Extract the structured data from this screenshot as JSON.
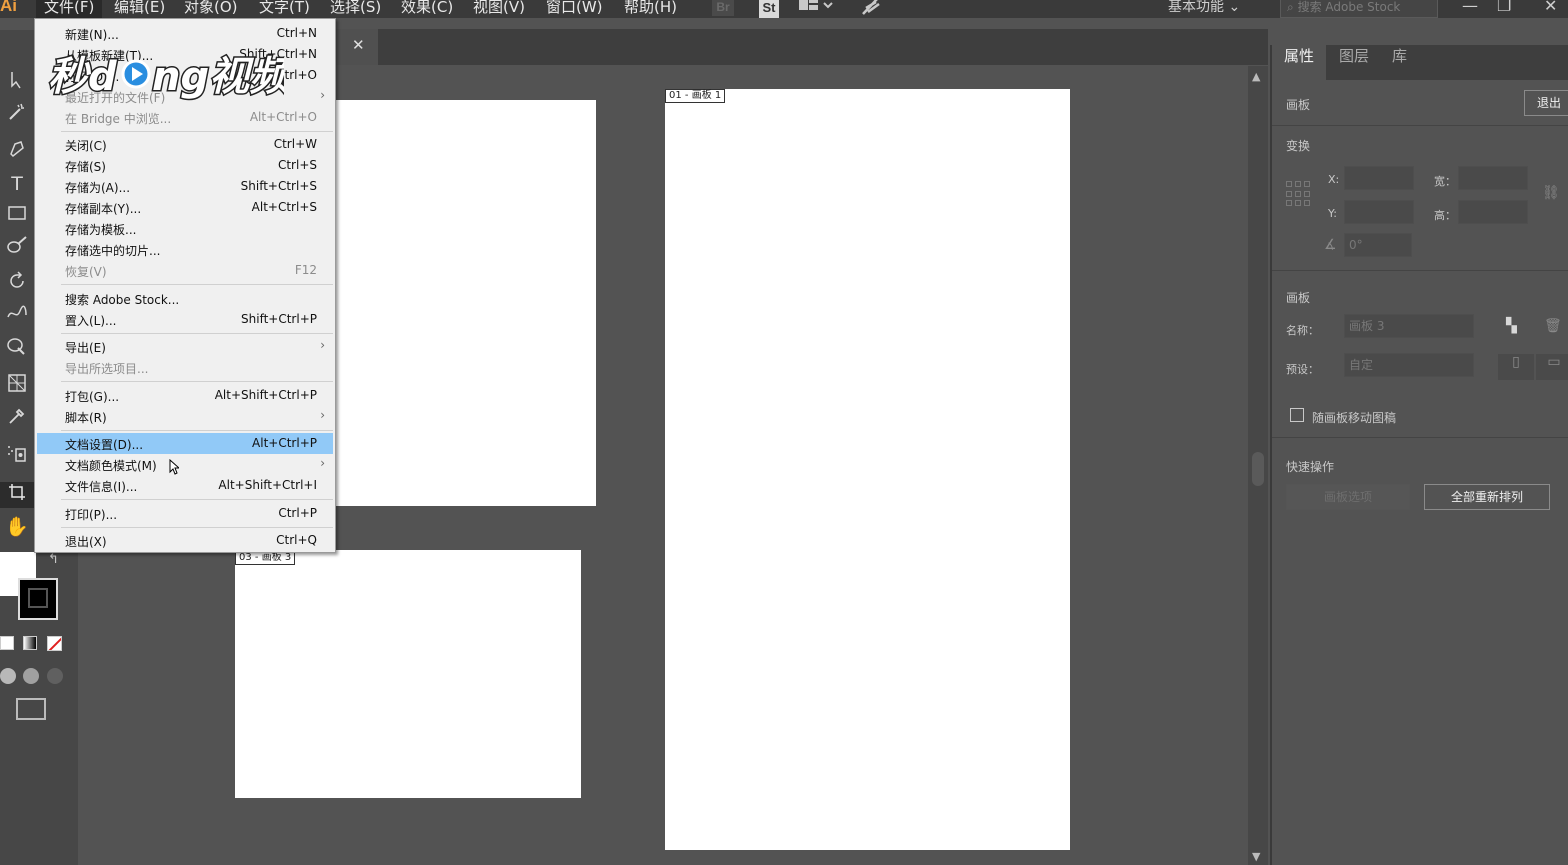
{
  "menubar": {
    "app_logo": "Ai",
    "menus": [
      {
        "label": "文件(F)"
      },
      {
        "label": "编辑(E)"
      },
      {
        "label": "对象(O)"
      },
      {
        "label": "文字(T)"
      },
      {
        "label": "选择(S)"
      },
      {
        "label": "效果(C)"
      },
      {
        "label": "视图(V)"
      },
      {
        "label": "窗口(W)"
      },
      {
        "label": "帮助(H)"
      }
    ],
    "bridge_icon": "Br",
    "stock_icon": "St",
    "workspace": "基本功能",
    "search_placeholder": "搜索 Adobe Stock"
  },
  "watermark": {
    "text": "秒懂视频"
  },
  "file_menu": {
    "items": [
      {
        "label": "新建(N)...",
        "shortcut": "Ctrl+N",
        "disabled": false
      },
      {
        "label": "从模板新建(T)...",
        "shortcut": "Shift+Ctrl+N",
        "disabled": false
      },
      {
        "label": "打开(O)...",
        "shortcut": "Ctrl+O",
        "disabled": false
      },
      {
        "label": "最近打开的文件(F)",
        "shortcut": "",
        "submenu": true,
        "disabled": true
      },
      {
        "label": "在 Bridge 中浏览...",
        "shortcut": "Alt+Ctrl+O",
        "disabled": true
      },
      {
        "label": "关闭(C)",
        "shortcut": "Ctrl+W",
        "disabled": false
      },
      {
        "label": "存储(S)",
        "shortcut": "Ctrl+S",
        "disabled": false
      },
      {
        "label": "存储为(A)...",
        "shortcut": "Shift+Ctrl+S",
        "disabled": false
      },
      {
        "label": "存储副本(Y)...",
        "shortcut": "Alt+Ctrl+S",
        "disabled": false
      },
      {
        "label": "存储为模板...",
        "shortcut": "",
        "disabled": false
      },
      {
        "label": "存储选中的切片...",
        "shortcut": "",
        "disabled": false
      },
      {
        "label": "恢复(V)",
        "shortcut": "F12",
        "disabled": true
      },
      {
        "label": "搜索 Adobe Stock...",
        "shortcut": "",
        "disabled": false
      },
      {
        "label": "置入(L)...",
        "shortcut": "Shift+Ctrl+P",
        "disabled": false
      },
      {
        "label": "导出(E)",
        "shortcut": "",
        "submenu": true,
        "disabled": false
      },
      {
        "label": "导出所选项目...",
        "shortcut": "",
        "disabled": true
      },
      {
        "label": "打包(G)...",
        "shortcut": "Alt+Shift+Ctrl+P",
        "disabled": false
      },
      {
        "label": "脚本(R)",
        "shortcut": "",
        "submenu": true,
        "disabled": false
      },
      {
        "label": "文档设置(D)...",
        "shortcut": "Alt+Ctrl+P",
        "disabled": false,
        "highlighted": true
      },
      {
        "label": "文档颜色模式(M)",
        "shortcut": "",
        "submenu": true,
        "disabled": false
      },
      {
        "label": "文件信息(I)...",
        "shortcut": "Alt+Shift+Ctrl+I",
        "disabled": false
      },
      {
        "label": "打印(P)...",
        "shortcut": "Ctrl+P",
        "disabled": false
      },
      {
        "label": "退出(X)",
        "shortcut": "Ctrl+Q",
        "disabled": false
      }
    ]
  },
  "canvas": {
    "artboards": [
      {
        "label": "01 - 画板 1"
      },
      {
        "label": "03 - 画板 3"
      }
    ]
  },
  "properties_panel": {
    "tabs": [
      "属性",
      "图层",
      "库"
    ],
    "artboard_header": "画板",
    "exit_button": "退出",
    "transform_title": "变换",
    "x_label": "X:",
    "y_label": "Y:",
    "w_label": "宽：",
    "h_label": "高：",
    "angle_value": "0°",
    "artboard_section": "画板",
    "name_label": "名称：",
    "name_value": "画板 3",
    "preset_label": "预设：",
    "preset_value": "自定",
    "move_with_artboard": "随画板移动图稿",
    "quick_actions_title": "快速操作",
    "artboard_options_button": "画板选项",
    "rearrange_all_button": "全部重新排列"
  },
  "colors": {
    "menu_highlight": "#91c9f7",
    "menubar_bg": "#3a3a3a",
    "panel_bg": "#535353",
    "artboard_bg": "#ffffff"
  }
}
